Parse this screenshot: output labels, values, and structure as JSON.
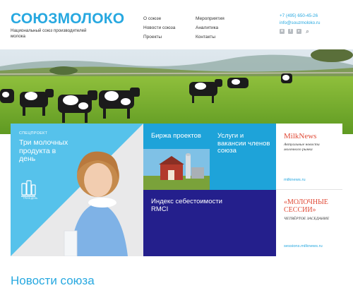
{
  "header": {
    "logo": "СОЮЗМОЛОКО",
    "tagline": "Национальный союз производителей молока",
    "nav_col1": [
      "О союзе",
      "Новости союза",
      "Проекты"
    ],
    "nav_col2": [
      "Мероприятия",
      "Аналитика",
      "Контакты"
    ],
    "phone": "+7 (495) 650-45-26",
    "email": "info@souzmoloko.ru",
    "socials": [
      "vk-icon",
      "facebook-icon",
      "youtube-icon",
      "search-icon"
    ]
  },
  "tiles": {
    "special": {
      "label": "СПЕЦПРОЕКТ",
      "title": "Три молочных продукта в день",
      "badge": "ТРИ В ДЕНЬ"
    },
    "exchange": {
      "title": "Биржа проектов"
    },
    "services": {
      "title": "Услуги и вакансии членов союза"
    },
    "index": {
      "title": "Индекс себестоимости RMCI"
    },
    "milknews": {
      "brand": "MilkNews",
      "desc": "Актуальные новости молочного рынка",
      "url": "milknews.ru"
    },
    "sessions": {
      "brand": "«МОЛОЧНЫЕ СЕССИИ»",
      "desc": "ЧЕТВЁРТОЕ ЗАСЕДАНИЕ",
      "url": "sessions.milknews.ru"
    }
  },
  "news": {
    "title": "Новости союза"
  },
  "colors": {
    "brand_blue": "#27a8e0",
    "tile_blue": "#1ea3d9",
    "tile_navy": "#241f8c",
    "accent_red": "#e04a36"
  }
}
